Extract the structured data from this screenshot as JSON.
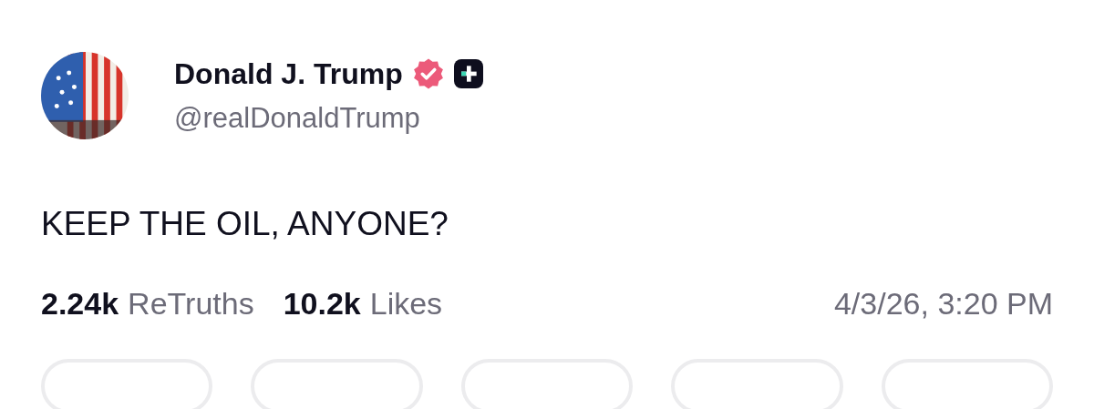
{
  "post": {
    "author": {
      "name": "Donald J. Trump",
      "verified": true,
      "handle": "@realDonaldTrump"
    },
    "text": "KEEP THE OIL, ANYONE?",
    "stats": [
      {
        "count": "2.24k",
        "label": "ReTruths"
      },
      {
        "count": "10.2k",
        "label": "Likes"
      }
    ],
    "timestamp": "4/3/26, 3:20 PM"
  }
}
